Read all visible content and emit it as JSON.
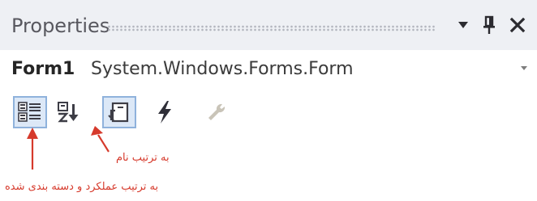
{
  "window": {
    "title": "Properties",
    "controls": {
      "dropdown_icon": "dropdown-arrow-icon",
      "pin_icon": "pin-icon",
      "close_icon": "close-icon"
    }
  },
  "object_selector": {
    "name": "Form1",
    "type": "System.Windows.Forms.Form"
  },
  "toolbar": {
    "buttons": [
      {
        "id": "categorized",
        "icon": "categorized-icon",
        "selected": true
      },
      {
        "id": "alphabetical",
        "icon": "alphabetical-sort-icon",
        "selected": false
      },
      {
        "id": "properties",
        "icon": "properties-page-icon",
        "selected": true
      },
      {
        "id": "events",
        "icon": "events-lightning-icon",
        "selected": false
      },
      {
        "id": "property-pages",
        "icon": "wrench-icon",
        "selected": false,
        "disabled": true
      }
    ]
  },
  "annotations": {
    "alphabetical": "به ترتیب نام",
    "categorized": "به ترتیب عملکرد و دسته بندی شده"
  },
  "colors": {
    "annotation": "#d63a2c",
    "selected_bg": "#dce8f7",
    "selected_border": "#8fb2dc",
    "titlebar_bg": "#eef0f4"
  }
}
